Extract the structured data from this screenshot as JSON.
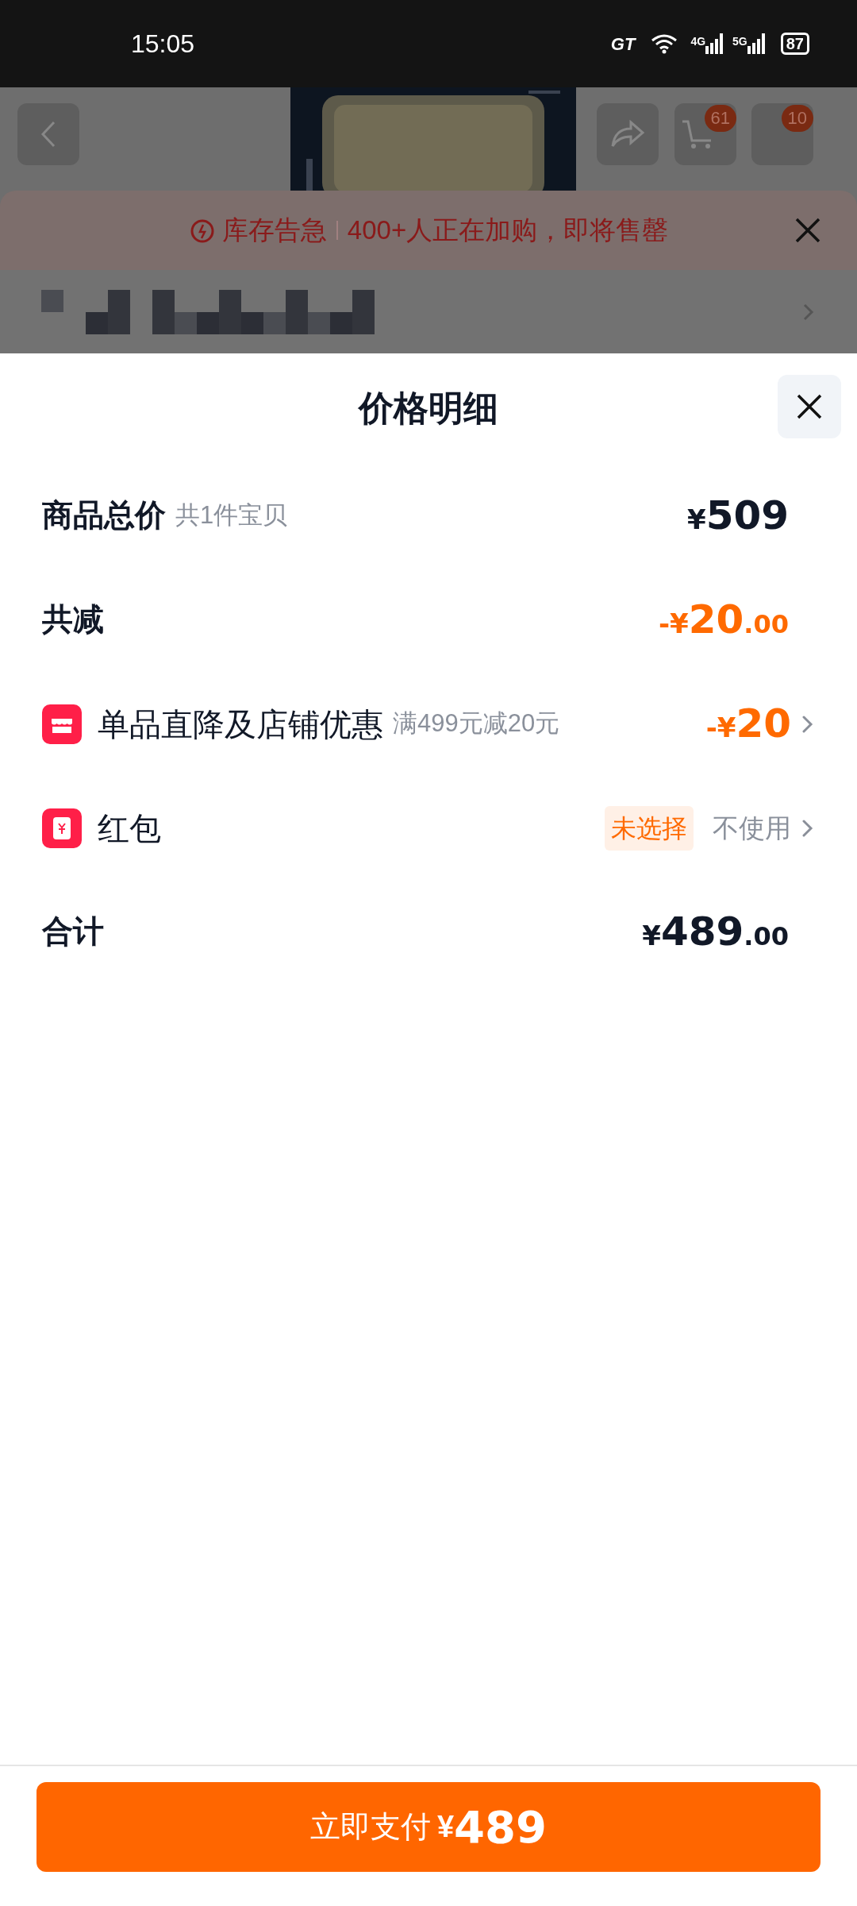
{
  "status_bar": {
    "time": "15:05",
    "carrier_logo": "GT",
    "networks": [
      "4G",
      "5G"
    ],
    "battery": "87"
  },
  "background_page": {
    "cart_badge": "61",
    "message_badge": "10",
    "banner": {
      "label": "库存告急",
      "message": "400+人正在加购，即将售罄"
    }
  },
  "sheet": {
    "title": "价格明细",
    "rows": [
      {
        "kind": "total",
        "label": "商品总价",
        "note": "共1件宝贝",
        "prefix": "¥",
        "main": "509",
        "highlight": false
      },
      {
        "kind": "reduction",
        "label": "共减",
        "prefix": "-¥",
        "main": "20",
        "decimals": ".00",
        "highlight": true
      },
      {
        "kind": "promo",
        "label": "单品直降及店铺优惠",
        "note": "满499元减20元",
        "prefix": "-¥",
        "main": "20",
        "highlight": true
      },
      {
        "kind": "redpacket",
        "label": "红包",
        "tag": "未选择",
        "value": "不使用"
      },
      {
        "kind": "sum",
        "label": "合计",
        "prefix": "¥",
        "main": "489",
        "decimals": ".00",
        "highlight": false
      }
    ]
  },
  "pay_button": {
    "label": "立即支付",
    "prefix": "¥",
    "main": "489"
  }
}
